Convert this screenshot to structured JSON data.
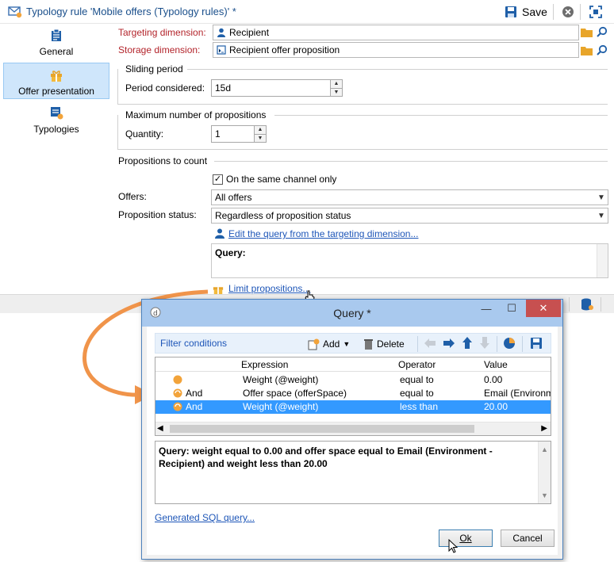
{
  "window": {
    "title": "Typology rule 'Mobile offers (Typology rules)' *",
    "save_label": "Save"
  },
  "sidebar": {
    "items": [
      {
        "label": "General",
        "icon": "general-icon"
      },
      {
        "label": "Offer presentation",
        "icon": "gift-icon",
        "selected": true
      },
      {
        "label": "Typologies",
        "icon": "typologies-icon"
      }
    ]
  },
  "form": {
    "targeting_label": "Targeting dimension:",
    "targeting_value": "Recipient",
    "storage_label": "Storage dimension:",
    "storage_value": "Recipient offer proposition",
    "sliding_title": "Sliding period",
    "period_label": "Period considered:",
    "period_value": "15d",
    "max_title": "Maximum number of propositions",
    "quantity_label": "Quantity:",
    "quantity_value": "1",
    "count_title": "Propositions to count",
    "same_channel_label": "On the same channel only",
    "same_channel_checked": true,
    "offers_label": "Offers:",
    "offers_value": "All offers",
    "status_label": "Proposition status:",
    "status_value": "Regardless of proposition status",
    "edit_query_link": "Edit the query from the targeting dimension...",
    "query_label": "Query:",
    "limit_link": "Limit propositions..."
  },
  "dialog": {
    "title": "Query *",
    "filter_conditions": "Filter conditions",
    "add_label": "Add",
    "delete_label": "Delete",
    "columns": [
      "Expression",
      "Operator",
      "Value"
    ],
    "rows": [
      {
        "prefix": "",
        "expression": "Weight (@weight)",
        "operator": "equal to",
        "value": "0.00",
        "selected": false
      },
      {
        "prefix": "And",
        "expression": "Offer space (offerSpace)",
        "operator": "equal to",
        "value": "Email (Environm",
        "selected": false
      },
      {
        "prefix": "And",
        "expression": "Weight (@weight)",
        "operator": "less than",
        "value": "20.00",
        "selected": true
      }
    ],
    "query_text": "Query: weight equal to 0.00 and offer space equal to Email (Environment - Recipient) and weight less than 20.00",
    "sql_link": "Generated SQL query...",
    "ok_label": "Ok",
    "cancel_label": "Cancel"
  },
  "colors": {
    "accent": "#1e56b8",
    "required_label": "#b3242b",
    "selection": "#3399ff",
    "callout_arrow": "#f0944a"
  }
}
